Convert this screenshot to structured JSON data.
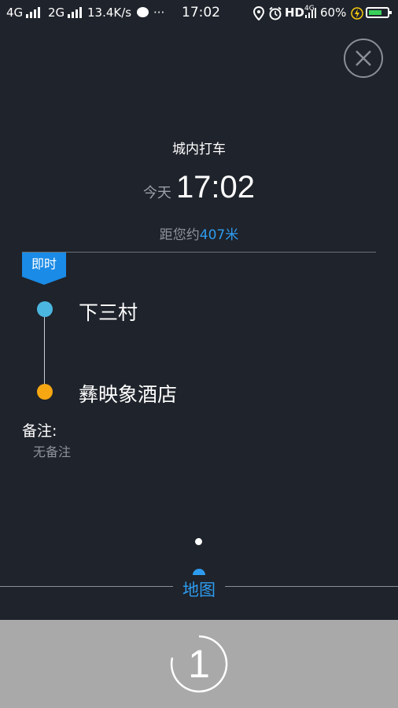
{
  "status_bar": {
    "net1": "4G",
    "net2": "2G",
    "speed": "13.4K/s",
    "more": "···",
    "time": "17:02",
    "hd": "HD",
    "net3": "4G",
    "battery": "60%"
  },
  "header": {
    "title": "城内打车",
    "time_prefix": "今天",
    "time": "17:02",
    "distance_prefix": "距您约",
    "distance_value": "407米"
  },
  "order": {
    "badge": "即时",
    "start": "下三村",
    "destination": "彝映象酒店",
    "remark_label": "备注:",
    "remark_value": "无备注"
  },
  "tabs": {
    "map": "地图"
  },
  "counter": {
    "value": "1"
  },
  "colors": {
    "accent": "#2d9cf0",
    "start_dot": "#4bb7e0",
    "end_dot": "#f6a712",
    "background": "#1f232b"
  }
}
